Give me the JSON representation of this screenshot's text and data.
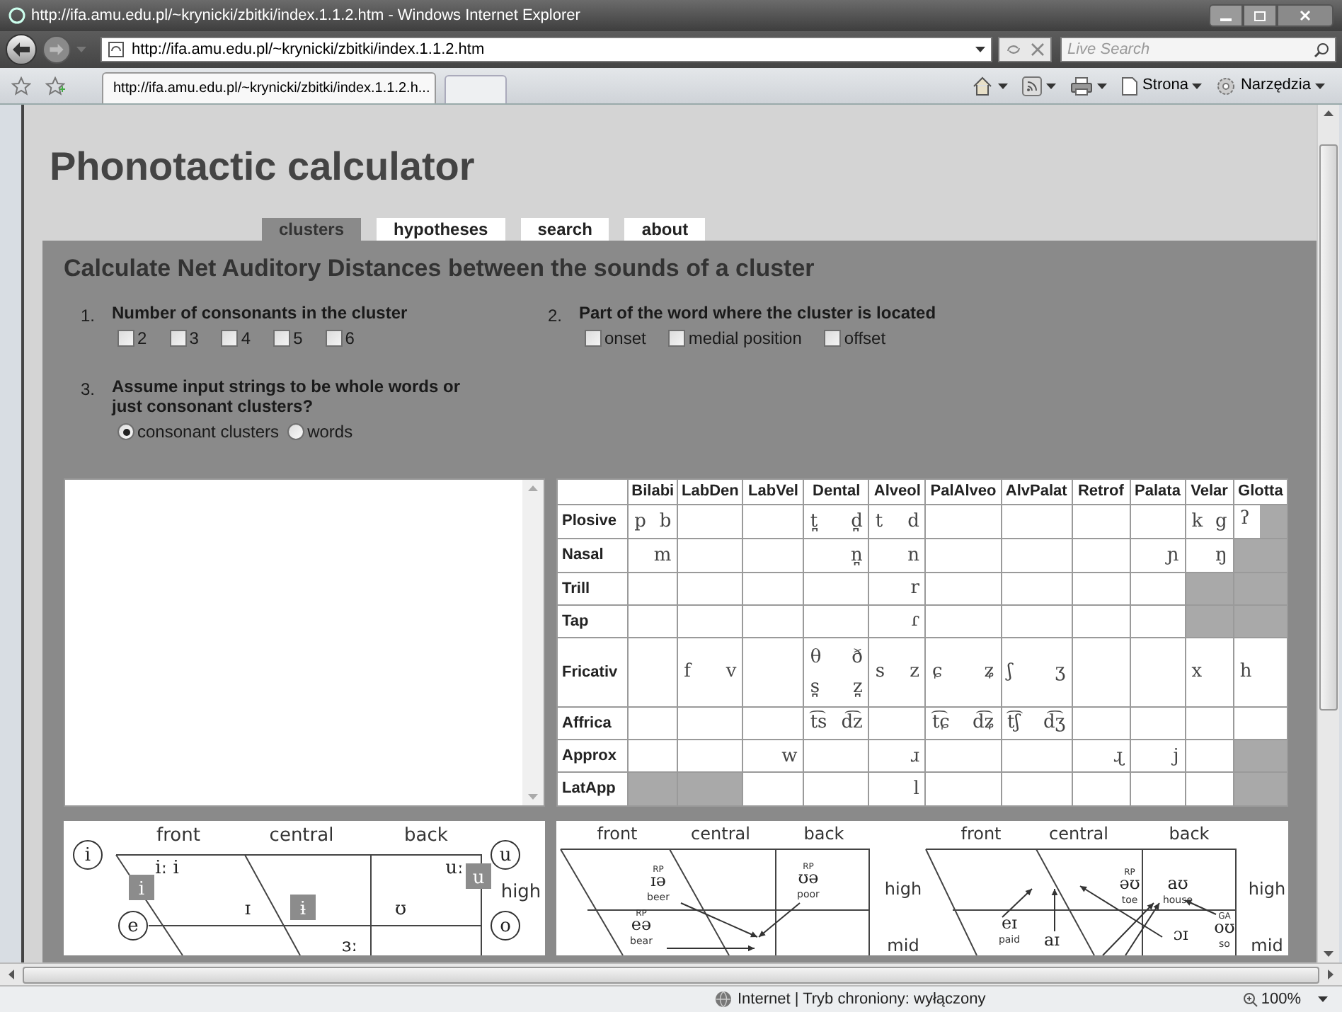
{
  "window": {
    "title": "http://ifa.amu.edu.pl/~krynicki/zbitki/index.1.1.2.htm - Windows Internet Explorer"
  },
  "address_bar": {
    "url": "http://ifa.amu.edu.pl/~krynicki/zbitki/index.1.1.2.htm"
  },
  "search": {
    "placeholder": "Live Search"
  },
  "browser_tab": {
    "title": "http://ifa.amu.edu.pl/~krynicki/zbitki/index.1.1.2.h..."
  },
  "command_bar": [
    {
      "kind": "home"
    },
    {
      "kind": "feeds"
    },
    {
      "kind": "print"
    },
    {
      "kind": "page",
      "label": "Strona"
    },
    {
      "kind": "tools",
      "label": "Narzędzia"
    }
  ],
  "page": {
    "title": "Phonotactic calculator",
    "tabs": [
      {
        "label": "clusters",
        "selected": true
      },
      {
        "label": "hypotheses",
        "selected": false
      },
      {
        "label": "search",
        "selected": false
      },
      {
        "label": "about",
        "selected": false
      }
    ],
    "heading": "Calculate Net Auditory Distances between the sounds of a cluster",
    "options": [
      {
        "number": "1.",
        "label": "Number of consonants in the cluster",
        "kind": "checkboxes",
        "choices": [
          {
            "label": "2",
            "checked": false
          },
          {
            "label": "3",
            "checked": false
          },
          {
            "label": "4",
            "checked": false
          },
          {
            "label": "5",
            "checked": false
          },
          {
            "label": "6",
            "checked": false
          }
        ]
      },
      {
        "number": "2.",
        "label": "Part of the word where the cluster is located",
        "kind": "checkboxes",
        "choices": [
          {
            "label": "onset",
            "checked": false
          },
          {
            "label": "medial position",
            "checked": false
          },
          {
            "label": "offset",
            "checked": false
          }
        ]
      },
      {
        "number": "3.",
        "label": "Assume input strings to be whole words or just consonant clusters?",
        "kind": "radios",
        "choices": [
          {
            "label": "consonant clusters",
            "selected": true
          },
          {
            "label": "words",
            "selected": false
          }
        ]
      }
    ],
    "consonant_table": {
      "columns": [
        "Bilabi",
        "LabDen",
        "LabVel",
        "Dental",
        "Alveol",
        "PalAlveo",
        "AlvPalat",
        "Retrof",
        "Palata",
        "Velar",
        "Glotta"
      ],
      "rows": [
        {
          "label": "Plosive",
          "cells": [
            {
              "kind": "sounds",
              "pairs": [
                {
                  "voiceless": "p",
                  "voiced": "b"
                }
              ]
            },
            {
              "kind": "blank"
            },
            {
              "kind": "blank"
            },
            {
              "kind": "sounds",
              "pairs": [
                {
                  "voiceless": "t̪",
                  "voiced": "d̪"
                }
              ]
            },
            {
              "kind": "sounds",
              "pairs": [
                {
                  "voiceless": "t",
                  "voiced": "d"
                }
              ]
            },
            {
              "kind": "blank"
            },
            {
              "kind": "blank"
            },
            {
              "kind": "blank"
            },
            {
              "kind": "blank"
            },
            {
              "kind": "sounds",
              "pairs": [
                {
                  "voiceless": "k",
                  "voiced": "g"
                }
              ]
            },
            {
              "kind": "half",
              "symbol": "ʔ"
            }
          ]
        },
        {
          "label": "Nasal",
          "cells": [
            {
              "kind": "sounds",
              "pairs": [
                {
                  "voiced": "m"
                }
              ]
            },
            {
              "kind": "blank"
            },
            {
              "kind": "blank"
            },
            {
              "kind": "sounds",
              "pairs": [
                {
                  "voiced": "n̪"
                }
              ]
            },
            {
              "kind": "sounds",
              "pairs": [
                {
                  "voiced": "n"
                }
              ]
            },
            {
              "kind": "blank"
            },
            {
              "kind": "blank"
            },
            {
              "kind": "blank"
            },
            {
              "kind": "sounds",
              "pairs": [
                {
                  "voiced": "ɲ"
                }
              ]
            },
            {
              "kind": "sounds",
              "pairs": [
                {
                  "voiced": "ŋ"
                }
              ]
            },
            {
              "kind": "shaded"
            }
          ]
        },
        {
          "label": "Trill",
          "cells": [
            {
              "kind": "blank"
            },
            {
              "kind": "blank"
            },
            {
              "kind": "blank"
            },
            {
              "kind": "blank"
            },
            {
              "kind": "sounds",
              "pairs": [
                {
                  "voiced": "r"
                }
              ]
            },
            {
              "kind": "blank"
            },
            {
              "kind": "blank"
            },
            {
              "kind": "blank"
            },
            {
              "kind": "blank"
            },
            {
              "kind": "shaded"
            },
            {
              "kind": "shaded"
            }
          ]
        },
        {
          "label": "Tap",
          "cells": [
            {
              "kind": "blank"
            },
            {
              "kind": "blank"
            },
            {
              "kind": "blank"
            },
            {
              "kind": "blank"
            },
            {
              "kind": "sounds",
              "pairs": [
                {
                  "voiced": "ɾ"
                }
              ]
            },
            {
              "kind": "blank"
            },
            {
              "kind": "blank"
            },
            {
              "kind": "blank"
            },
            {
              "kind": "blank"
            },
            {
              "kind": "shaded"
            },
            {
              "kind": "shaded"
            }
          ]
        },
        {
          "label": "Fricativ",
          "cells": [
            {
              "kind": "blank"
            },
            {
              "kind": "sounds",
              "pairs": [
                {
                  "voiceless": "f",
                  "voiced": "v"
                }
              ]
            },
            {
              "kind": "blank"
            },
            {
              "kind": "sounds",
              "pairs": [
                {
                  "voiceless": "θ",
                  "voiced": "ð"
                },
                {
                  "voiceless": "s̪",
                  "voiced": "z̪"
                }
              ]
            },
            {
              "kind": "sounds",
              "pairs": [
                {
                  "voiceless": "s",
                  "voiced": "z"
                }
              ]
            },
            {
              "kind": "sounds",
              "pairs": [
                {
                  "voiceless": "ɕ",
                  "voiced": "ʑ"
                }
              ]
            },
            {
              "kind": "sounds",
              "pairs": [
                {
                  "voiceless": "ʃ",
                  "voiced": "ʒ"
                }
              ]
            },
            {
              "kind": "blank"
            },
            {
              "kind": "blank"
            },
            {
              "kind": "sounds",
              "pairs": [
                {
                  "voiceless": "x"
                }
              ]
            },
            {
              "kind": "sounds",
              "pairs": [
                {
                  "voiceless": "h"
                }
              ]
            }
          ]
        },
        {
          "label": "Affrica",
          "cells": [
            {
              "kind": "blank"
            },
            {
              "kind": "blank"
            },
            {
              "kind": "blank"
            },
            {
              "kind": "sounds",
              "pairs": [
                {
                  "voiceless": "t͡s",
                  "voiced": "d͡z"
                }
              ]
            },
            {
              "kind": "blank"
            },
            {
              "kind": "sounds",
              "pairs": [
                {
                  "voiceless": "t͡ɕ",
                  "voiced": "d͡ʑ"
                }
              ]
            },
            {
              "kind": "sounds",
              "pairs": [
                {
                  "voiceless": "t͡ʃ",
                  "voiced": "d͡ʒ"
                }
              ]
            },
            {
              "kind": "blank"
            },
            {
              "kind": "blank"
            },
            {
              "kind": "blank"
            },
            {
              "kind": "blank"
            }
          ]
        },
        {
          "label": "Approx",
          "cells": [
            {
              "kind": "blank"
            },
            {
              "kind": "blank"
            },
            {
              "kind": "sounds",
              "pairs": [
                {
                  "voiced": "w"
                }
              ]
            },
            {
              "kind": "blank"
            },
            {
              "kind": "sounds",
              "pairs": [
                {
                  "voiced": "ɹ"
                }
              ]
            },
            {
              "kind": "blank"
            },
            {
              "kind": "blank"
            },
            {
              "kind": "sounds",
              "pairs": [
                {
                  "voiced": "ɻ"
                }
              ]
            },
            {
              "kind": "sounds",
              "pairs": [
                {
                  "voiced": "j"
                }
              ]
            },
            {
              "kind": "blank"
            },
            {
              "kind": "shaded"
            }
          ]
        },
        {
          "label": "LatApp",
          "cells": [
            {
              "kind": "shaded"
            },
            {
              "kind": "shaded"
            },
            {
              "kind": "blank"
            },
            {
              "kind": "blank"
            },
            {
              "kind": "sounds",
              "pairs": [
                {
                  "voiced": "l"
                }
              ]
            },
            {
              "kind": "blank"
            },
            {
              "kind": "blank"
            },
            {
              "kind": "blank"
            },
            {
              "kind": "blank"
            },
            {
              "kind": "blank"
            },
            {
              "kind": "shaded"
            }
          ]
        }
      ]
    },
    "vowel_chart": {
      "column_labels": [
        "front",
        "central",
        "back"
      ],
      "row_labels": [
        "high"
      ],
      "symbols": [
        {
          "kind": "circled",
          "text": "i"
        },
        {
          "kind": "circled",
          "text": "e"
        },
        {
          "kind": "circled",
          "text": "u"
        },
        {
          "kind": "circled",
          "text": "o"
        },
        {
          "kind": "plain",
          "text": "iː i"
        },
        {
          "kind": "boxed",
          "text": "i"
        },
        {
          "kind": "plain",
          "text": "ɪ"
        },
        {
          "kind": "boxed",
          "text": "ɨ"
        },
        {
          "kind": "plain",
          "text": "ʊ"
        },
        {
          "kind": "plain",
          "text": "uː"
        },
        {
          "kind": "boxed",
          "text": "u"
        },
        {
          "kind": "plain",
          "text": "ɜː"
        }
      ]
    },
    "diphthong_charts": [
      {
        "column_labels": [
          "front",
          "central",
          "back"
        ],
        "row_labels": [
          "high",
          "mid"
        ],
        "symbols": [
          {
            "text": "ɪə",
            "tag": "RP",
            "word": "beer"
          },
          {
            "text": "ʊə",
            "tag": "RP",
            "word": "poor"
          },
          {
            "text": "eə",
            "tag": "RP",
            "word": "bear"
          }
        ]
      },
      {
        "column_labels": [
          "front",
          "central",
          "back"
        ],
        "row_labels": [
          "high",
          "mid"
        ],
        "symbols": [
          {
            "text": "əʊ",
            "tag": "RP",
            "word": "toe"
          },
          {
            "text": "aʊ",
            "word": "house"
          },
          {
            "text": "eɪ",
            "word": "paid"
          },
          {
            "text": "aɪ"
          },
          {
            "text": "ɔɪ"
          },
          {
            "text": "oʊ",
            "tag": "GA",
            "word": "so"
          }
        ]
      }
    ]
  },
  "status_bar": {
    "zone": "Internet | Tryb chroniony: wyłączony",
    "zoom": "100%"
  }
}
